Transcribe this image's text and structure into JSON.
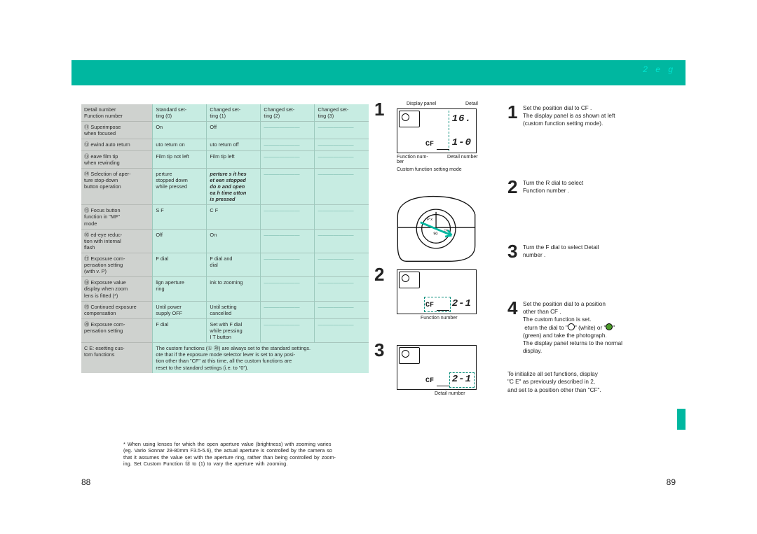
{
  "header": {
    "right_text": "2   e     g"
  },
  "pages": {
    "left": "88",
    "right": "89"
  },
  "table": {
    "head": {
      "col0_top": "Detail number",
      "col0_bot": "Function number",
      "c1a": "Standard set-",
      "c1b": "ting (0)",
      "c2a": "Changed set-",
      "c2b": "ting (1)",
      "c3a": "Changed set-",
      "c3b": "ting (2)",
      "c4a": "Changed set-",
      "c4b": "ting (3)"
    },
    "rows": [
      {
        "n": "⑪",
        "label": "Superimpose\nwhen focused",
        "c1": "On",
        "c2": "Off",
        "c3": "———————",
        "c4": "———————"
      },
      {
        "n": "⑫",
        "label": " ewind auto return",
        "c1": " uto return on",
        "c2": " uto return off",
        "c3": "———————",
        "c4": "———————"
      },
      {
        "n": "⑬",
        "label": " eave film tip\nwhen rewinding",
        "c1": "Film tip not left",
        "c2": "Film tip left",
        "c3": "———————",
        "c4": "———————"
      },
      {
        "n": "⑭",
        "label": "Selection of aper-\nture stop-down\nbutton operation",
        "c1": " perture\nstopped down\nwhile pressed",
        "c2": "  perture s it hes\n et een stopped\ndo n and open\nea h time  utton\nis pressed",
        "c3": "———————",
        "c4": "———————",
        "em2": true
      },
      {
        "n": "⑮",
        "label": "Focus button\nfunction in \"MF\"\nmode",
        "c1": "S   F",
        "c2": "C   F",
        "c3": "———————",
        "c4": "———————"
      },
      {
        "n": "⑯",
        "label": " ed-eye reduc-\ntion with internal\nflash",
        "c1": "Off",
        "c2": "On",
        "c3": "———————",
        "c4": "———————"
      },
      {
        "n": "⑰",
        "label": "Exposure com-\npensation setting\n(with   v. P)",
        "c1": "F dial",
        "c2": "F dial and\n  dial",
        "c3": "———————",
        "c4": "———————"
      },
      {
        "n": "⑱",
        "label": "Exposure value\ndisplay when zoom\nlens is fitted (*)",
        "c1": " lign aperture\nring",
        "c2": " ink to zooming",
        "c3": "———————",
        "c4": "———————"
      },
      {
        "n": "⑲",
        "label": "Continued exposure\ncompensation",
        "c1": "Until power\nsupply OFF",
        "c2": "Until setting\ncancelled",
        "c3": "———————",
        "c4": "———————"
      },
      {
        "n": "⑳",
        "label": "Exposure com-\npensation setting",
        "c1": "F dial",
        "c2": "Set with F dial\nwhile pressing\nI     T button",
        "c3": "———————",
        "c4": "———————"
      }
    ],
    "bottom": {
      "label": "C   E:   esetting cus-\ntom functions",
      "note": "The custom functions (①    ⑳) are always set to the standard settings.\n ote that if the exposure mode selector lever is set to any posi-\ntion other than \"CF\" at this time, all the custom functions are\nreset to the standard settings (i.e. to \"0\")."
    }
  },
  "footnote": "* When using lenses for which the open aperture value (brightness) with zooming varies\n(eg. Vario Sonnar 28-80mm F3.5-5.6), the actual aperture is controlled by the camera so\nthat it assumes the value set with the aperture ring, rather than being controlled by zoom-\ning. Set Custom Function ⑱ to (1) to vary the aperture with zooming.",
  "illus": {
    "s1": {
      "big": "1",
      "cap_top": "Display panel",
      "cap_top_r": "Detail",
      "lcd1": "16.",
      "cf": "CF",
      "lcd2": "1-0",
      "cap_l": "Function num-\nber",
      "cap_r": "Detail number",
      "cap_b": "Custom function setting mode"
    },
    "s2": {
      "big": "2",
      "cf": "CF",
      "lcd": "2-1",
      "cap": "Function number"
    },
    "s3": {
      "big": "3",
      "cf": "CF",
      "lcd": "2-1",
      "cap": "Detail number"
    }
  },
  "steps": {
    "s1": {
      "n": "1",
      "t1": "Set the position dial to  CF .",
      "p1": "The display panel is as shown at left\n(custom function setting mode)."
    },
    "s2": {
      "n": "2",
      "t1": "Turn the R dial to select\n Function number ."
    },
    "s3": {
      "n": "3",
      "t1": " Turn the F dial to select  Detail\nnumber ."
    },
    "s4": {
      "n": "4",
      "t1": "Set the position dial to a position",
      "t2": " other than  CF .",
      "p1": "The custom function is set.",
      "p2": " eturn the dial to \"     \" (white) or \"     \"\n(green) and take the photograph.",
      "p3": "The display panel returns to the normal\ndisplay."
    },
    "note": "To initialize all set functions, display\n\"C   E\" as previously described in 2,\nand set to a position other than \"CF\"."
  }
}
